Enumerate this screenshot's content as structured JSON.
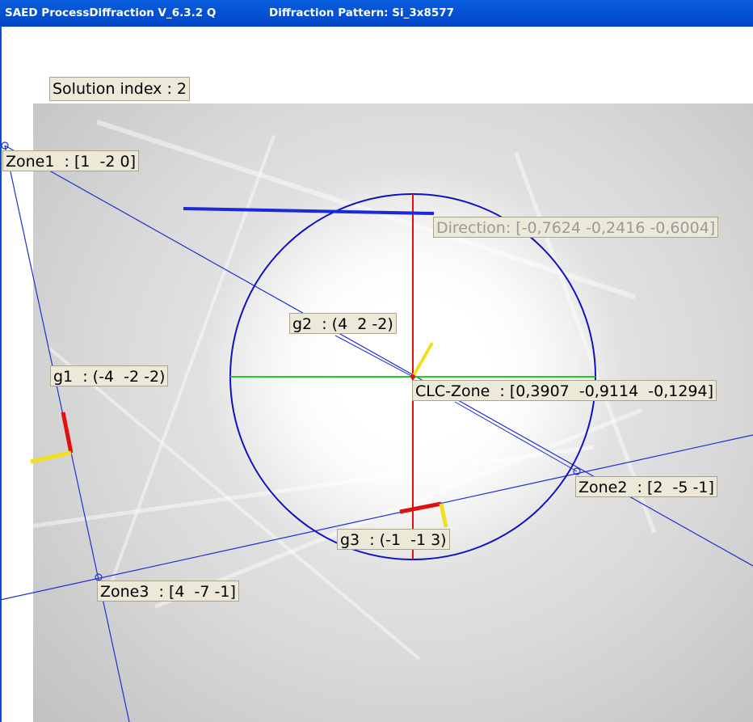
{
  "window": {
    "app_title": "SAED ProcessDiffraction V_6.3.2 Q",
    "document_title": "Diffraction Pattern: Si_3x8577"
  },
  "solution": {
    "label": "Solution index : 2"
  },
  "labels": {
    "zone1": "Zone1  : [1  -2 0]",
    "direction": "Direction: [-0,7624 -0,2416 -0,6004]",
    "g2": "g2  : (4  2 -2)",
    "g1": "g1  : (-4  -2 -2)",
    "clc_zone": "CLC-Zone  : [0,3907  -0,9114  -0,1294]",
    "zone2": "Zone2  : [2  -5 -1]",
    "g3": "g3  : (-1  -1 3)",
    "zone3": "Zone3  : [4  -7 -1]"
  },
  "colors": {
    "titlebar": "#0553d6",
    "circle": "#1010c0",
    "zone_line": "#1f2fd0",
    "direction_line": "#1a2ad8",
    "vertical_axis": "#e01010",
    "horizontal_axis": "#22cc22",
    "g_vector_red": "#e01010",
    "g_vector_yellow": "#f0e020",
    "label_bg": "#ece9d8"
  }
}
